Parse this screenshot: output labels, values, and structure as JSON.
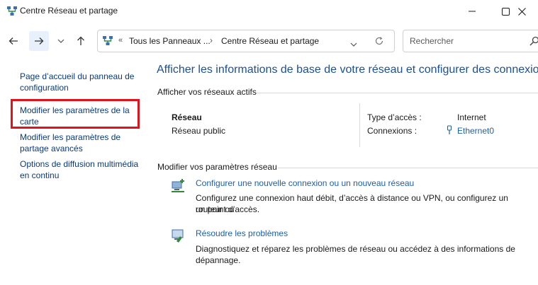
{
  "window": {
    "title": "Centre Réseau et partage"
  },
  "addressbar": {
    "overflow_chevron": "«",
    "crumb_1": "Tous les Panneaux ...",
    "separator": "›",
    "crumb_2": "Centre Réseau et partage"
  },
  "search": {
    "placeholder": "Rechercher"
  },
  "sidebar": {
    "items": [
      {
        "label": "Page d’accueil du panneau de configuration"
      },
      {
        "label": "Modifier les paramètres de la carte"
      },
      {
        "label": "Modifier les paramètres de partage avancés"
      },
      {
        "label": "Options de diffusion multimédia en continu"
      }
    ]
  },
  "main": {
    "title": "Afficher les informations de base de votre réseau et configurer des connexions",
    "active_networks_label": "Afficher vos réseaux actifs",
    "network": {
      "name": "Réseau",
      "category": "Réseau public",
      "access_type_label": "Type d’accès :",
      "access_type_value": "Internet",
      "connections_label": "Connexions :",
      "connections_value": "Ethernet0"
    },
    "change_settings_label": "Modifier vos paramètres réseau",
    "tasks": [
      {
        "title": "Configurer une nouvelle connexion ou un nouveau réseau",
        "line_1": "Configurez une connexion haut débit, d’accès à distance ou VPN, ou configurez un routeur ou",
        "line_2": "un point d’accès."
      },
      {
        "title": "Résoudre les problèmes",
        "line_1": "Diagnostiquez et réparez les problèmes de réseau ou accédez à des informations de",
        "line_2": "dépannage."
      }
    ]
  },
  "colors": {
    "link": "#1d5fa8",
    "title": "#1d4f91",
    "highlight": "#e0121b"
  }
}
